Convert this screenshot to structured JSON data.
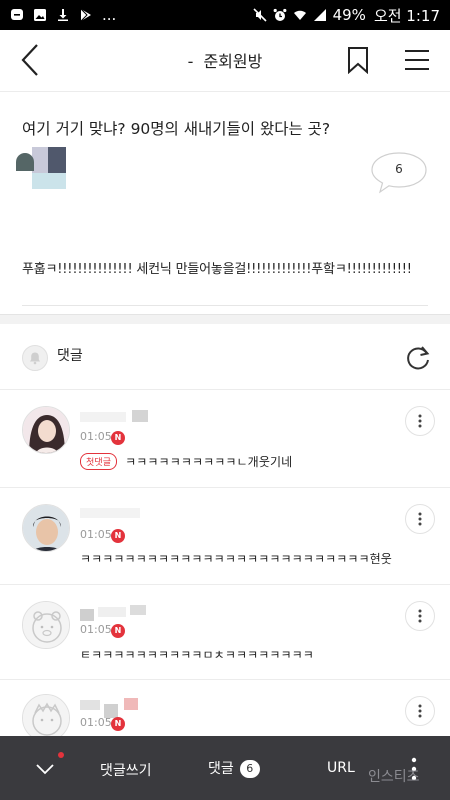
{
  "status_bar": {
    "left_icons": [
      "kakaotalk-icon",
      "gallery-icon",
      "download-icon",
      "playstore-icon"
    ],
    "more_indicator": "...",
    "right_icons": [
      "mute-icon",
      "alarm-icon",
      "wifi-icon",
      "signal-icon"
    ],
    "battery": "49%",
    "time": "오전 1:17"
  },
  "header": {
    "back_icon": "chevron-left-icon",
    "title_prefix": "-",
    "title": "준회원방",
    "bookmark_icon": "bookmark-icon",
    "menu_icon": "hamburger-icon"
  },
  "post": {
    "title": "여기 거기 맞냐? 90명의 새내기들이 왔다는 곳?",
    "comment_count": "6",
    "body": "푸훕ㅋ!!!!!!!!!!!!!!! 세컨닉 만들어놓을걸!!!!!!!!!!!!!푸핰ㅋ!!!!!!!!!!!!!"
  },
  "comments_section": {
    "label": "댓글",
    "bell_icon": "bell-icon",
    "refresh_icon": "refresh-icon"
  },
  "comments": [
    {
      "time": "01:05",
      "new_badge": "N",
      "first_badge": "첫댓글",
      "text": "ㅋㅋㅋㅋㅋㅋㅋㅋㅋㅋㄴ개웃기네"
    },
    {
      "time": "01:05",
      "new_badge": "N",
      "first_badge": "",
      "text": "ㅋㅋㅋㅋㅋㅋㅋㅋㅋㅋㅋㅋㅋㅋㅋㅋㅋㅋㅋㅋㅋㅋㅋㅋㅋㅋ현웃"
    },
    {
      "time": "01:05",
      "new_badge": "N",
      "first_badge": "",
      "text": "ㅌㅋㅋㅋㅋㅋㅋㅋㅋㅋㅋㅁㅊㅋㅋㅋㅋㅋㅋㅋㅋ"
    },
    {
      "time": "01:05",
      "new_badge": "N",
      "first_badge": "",
      "text": ""
    }
  ],
  "bottom_bar": {
    "write_comment": "댓글쓰기",
    "comments_label": "댓글",
    "comments_count": "6",
    "url_label": "URL"
  },
  "watermark": "인스티즈",
  "colors": {
    "accent_red": "#e3333c",
    "bottom_bar_bg": "#3a3a3e",
    "divider": "#ececec"
  }
}
